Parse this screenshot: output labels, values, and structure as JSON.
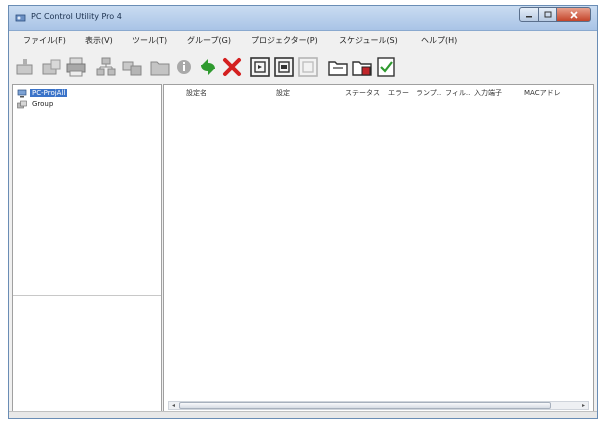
{
  "window": {
    "title": "PC Control Utility Pro 4"
  },
  "menu": [
    "ファイル(F)",
    "表示(V)",
    "ツール(T)",
    "グループ(G)",
    "プロジェクター(P)",
    "スケジュール(S)",
    "ヘルプ(H)"
  ],
  "toolbar": {
    "icons": [
      "add-projector-icon",
      "group-add-icon",
      "printer-icon",
      "network-search-icon",
      "group-move-icon",
      "group-folder-icon",
      "info-icon",
      "refresh-icon",
      "delete-icon",
      "power-on-icon",
      "power-off-icon",
      "input-switch-icon",
      "folder-open-icon",
      "folder-record-icon",
      "checklist-icon"
    ]
  },
  "tree": {
    "items": [
      {
        "label": "PC-ProjAll",
        "selected": true
      },
      {
        "label": "Group",
        "selected": false
      }
    ]
  },
  "list": {
    "columns": [
      "設定名",
      "設定",
      "ステータス",
      "エラー",
      "ランプ..",
      "フィル..",
      "入力端子",
      "MACアドレ"
    ]
  },
  "colors": {
    "titlebar": "#b8d0ec",
    "selection": "#3a73c9",
    "close_button": "#c4442a",
    "refresh": "#2f9a2f",
    "delete": "#d42020"
  }
}
